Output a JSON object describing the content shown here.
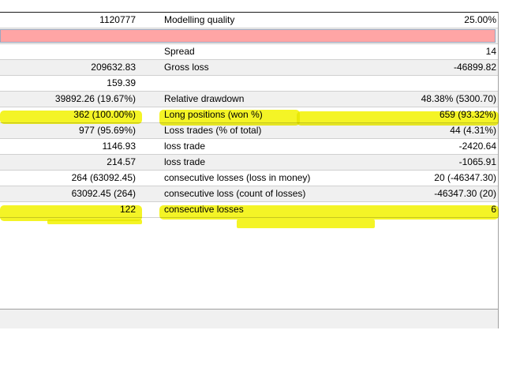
{
  "report": {
    "rows": [
      {
        "value": "1120777",
        "label": "Modelling quality",
        "value2": "25.00%"
      },
      {
        "type": "pink"
      },
      {
        "value": "",
        "label": "Spread",
        "value2": "14"
      },
      {
        "value": "209632.83",
        "label": "Gross loss",
        "value2": "-46899.82"
      },
      {
        "value": "159.39",
        "label": "",
        "value2": ""
      },
      {
        "value": "39892.26 (19.67%)",
        "label": "Relative drawdown",
        "value2": "48.38% (5300.70)"
      },
      {
        "value": "362 (100.00%)",
        "label": "Long positions (won %)",
        "value2": "659 (93.32%)"
      },
      {
        "value": "977 (95.69%)",
        "label": "Loss trades (% of total)",
        "value2": "44 (4.31%)"
      },
      {
        "value": "1146.93",
        "label": "loss trade",
        "value2": "-2420.64"
      },
      {
        "value": "214.57",
        "label": "loss trade",
        "value2": "-1065.91"
      },
      {
        "value": "264 (63092.45)",
        "label": "consecutive losses (loss in money)",
        "value2": "20 (-46347.30)"
      },
      {
        "value": "63092.45 (264)",
        "label": "consecutive loss (count of losses)",
        "value2": "-46347.30 (20)"
      },
      {
        "value": "122",
        "label": "consecutive losses",
        "value2": "6"
      }
    ]
  },
  "colors": {
    "highlight": "#f2f200",
    "pink_row": "#ffa5a5",
    "alt_row": "#f0f0f0"
  }
}
